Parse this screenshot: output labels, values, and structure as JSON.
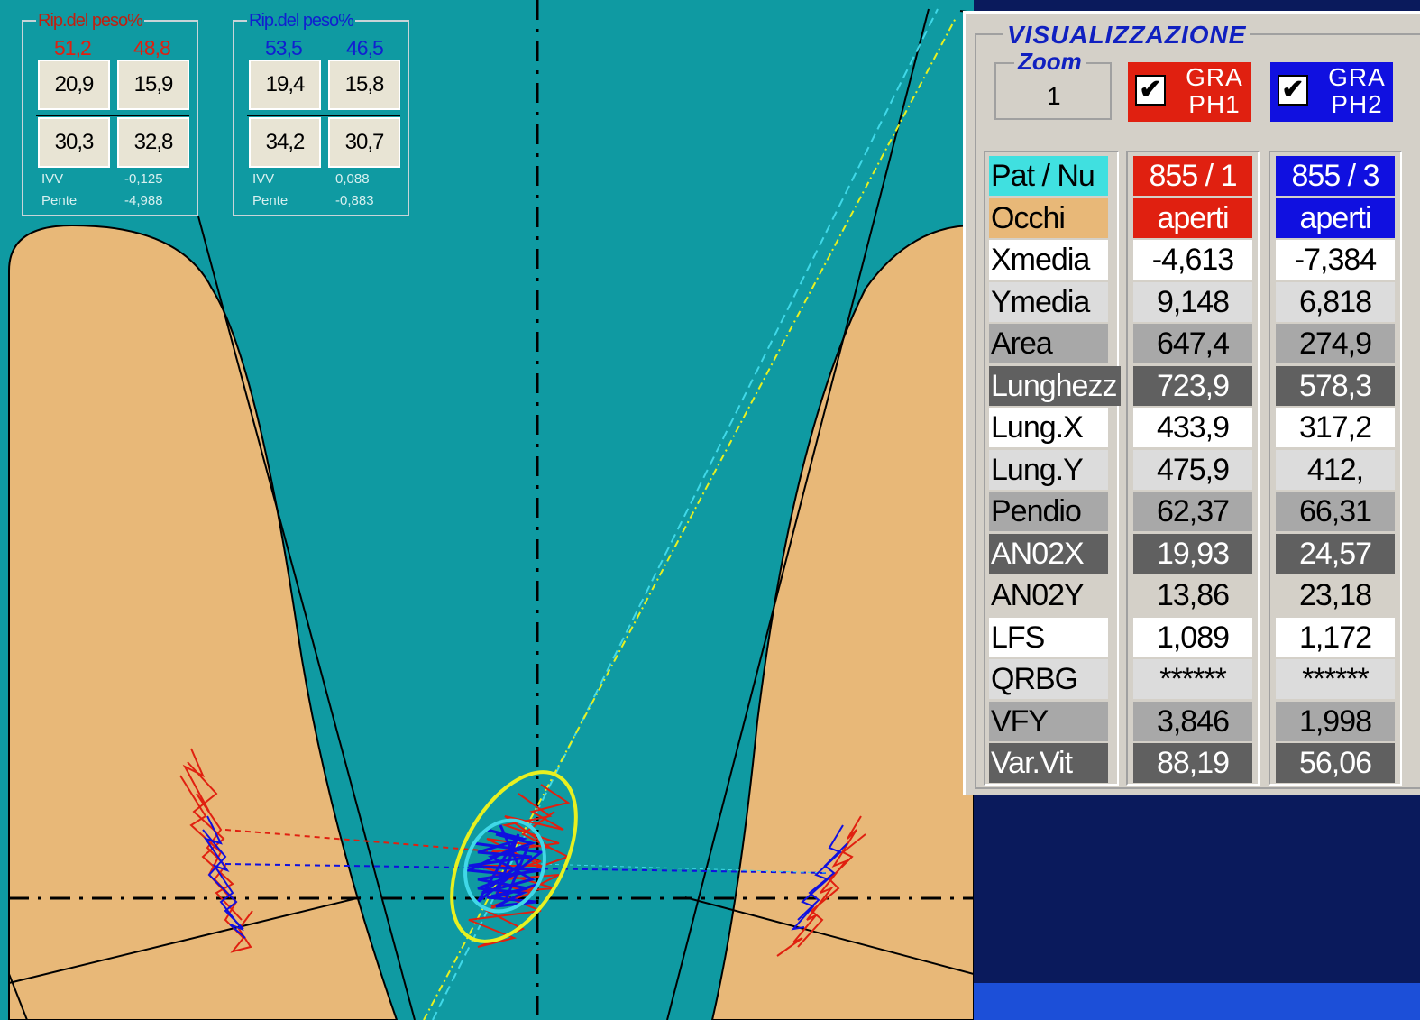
{
  "colors": {
    "foot": "#e8b878",
    "background": "#0f9aa2",
    "red_trace": "#e02010",
    "blue_trace": "#1010e0",
    "yellow_ellipse": "#e8f020",
    "cyan_ellipse": "#40d8e8",
    "pat_label": "#40e0e0",
    "occhi_label": "#e8b878",
    "red_column": "#e02010",
    "blue_column": "#1010e0"
  },
  "weight_box_1": {
    "title": "Rip.del peso%",
    "title_color": "#c02010",
    "left_pct": "51,2",
    "right_pct": "48,8",
    "pct_color": "#e02010",
    "cells": [
      "20,9",
      "15,9",
      "30,3",
      "32,8"
    ],
    "stat1_label": "IVV",
    "stat1_value": "-0,125",
    "stat2_label": "Pente",
    "stat2_value": "-4,988"
  },
  "weight_box_2": {
    "title": "Rip.del peso%",
    "title_color": "#1020d0",
    "left_pct": "53,5",
    "right_pct": "46,5",
    "pct_color": "#1020d0",
    "cells": [
      "19,4",
      "15,8",
      "34,2",
      "30,7"
    ],
    "stat1_label": "IVV",
    "stat1_value": "0,088",
    "stat2_label": "Pente",
    "stat2_value": "-0,883"
  },
  "panel": {
    "title": "VISUALIZZAZIONE",
    "zoom_label": "Zoom",
    "zoom_value": "1",
    "graph1_label_line1": "GRA",
    "graph1_label_line2": "PH1",
    "graph2_label_line1": "GRA",
    "graph2_label_line2": "PH2",
    "check_mark": "✔"
  },
  "table": {
    "rows": [
      {
        "label": "Pat / Nu",
        "v1": "855 /  1",
        "v2": "855 /  3"
      },
      {
        "label": "Occhi",
        "v1": "aperti",
        "v2": "aperti"
      },
      {
        "label": "Xmedia",
        "v1": "-4,613",
        "v2": "-7,384"
      },
      {
        "label": "Ymedia",
        "v1": "9,148",
        "v2": "6,818"
      },
      {
        "label": "Area",
        "v1": "647,4",
        "v2": "274,9"
      },
      {
        "label": "Lunghezz",
        "v1": "723,9",
        "v2": "578,3"
      },
      {
        "label": "Lung.X",
        "v1": "433,9",
        "v2": "317,2"
      },
      {
        "label": "Lung.Y",
        "v1": "475,9",
        "v2": "412,"
      },
      {
        "label": "Pendio",
        "v1": "62,37",
        "v2": "66,31"
      },
      {
        "label": "AN02X",
        "v1": "19,93",
        "v2": "24,57"
      },
      {
        "label": "AN02Y",
        "v1": "13,86",
        "v2": "23,18"
      },
      {
        "label": "LFS",
        "v1": "1,089",
        "v2": "1,172"
      },
      {
        "label": "QRBG",
        "v1": "******",
        "v2": "******"
      },
      {
        "label": "VFY",
        "v1": "3,846",
        "v2": "1,998"
      },
      {
        "label": "Var.Vit",
        "v1": "88,19",
        "v2": "56,06"
      }
    ]
  }
}
